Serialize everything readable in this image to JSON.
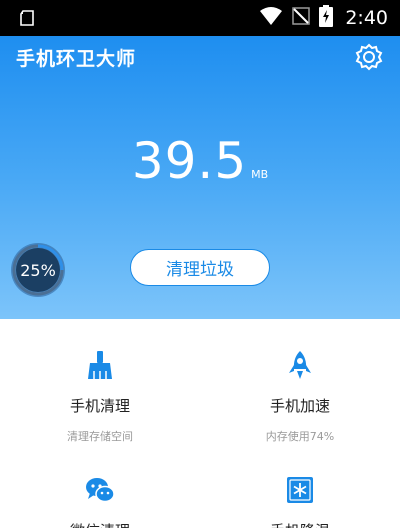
{
  "status_bar": {
    "time": "2:40",
    "icons": [
      "sim-icon",
      "wifi-icon",
      "no-signal-icon",
      "battery-charging-icon"
    ]
  },
  "header": {
    "app_title": "手机环卫大师",
    "settings_icon": "gear-icon"
  },
  "junk": {
    "value": "39.5",
    "unit": "MB"
  },
  "progress": {
    "percent_label": "25%",
    "fraction": 0.25
  },
  "clean_button": {
    "label": "清理垃圾"
  },
  "features": [
    {
      "label": "手机清理",
      "sub": "清理存储空间",
      "icon": "broom-icon"
    },
    {
      "label": "手机加速",
      "sub": "内存使用74%",
      "icon": "rocket-icon"
    },
    {
      "label": "微信清理",
      "icon": "wechat-icon"
    },
    {
      "label": "手机降温",
      "icon": "snowflake-icon"
    }
  ],
  "colors": {
    "accent": "#1a8ae6",
    "hero_top": "#1e8ef0",
    "hero_bottom": "#7cc4fa",
    "ring": "#2f8fe8"
  }
}
